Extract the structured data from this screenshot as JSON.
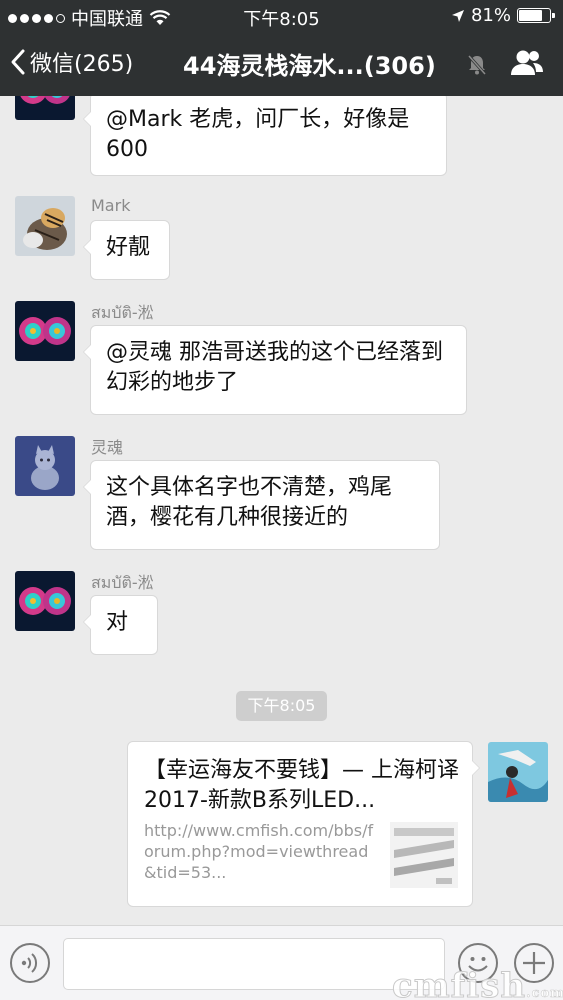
{
  "status_bar": {
    "carrier": "中国联通",
    "time": "下午8:05",
    "battery": "81%",
    "battery_level": 0.81
  },
  "nav": {
    "back_label": "微信(265)",
    "title": "44海灵栈海水...(306)"
  },
  "messages": [
    {
      "sender": "",
      "text": "@Mark 老虎，问厂长，好像是600"
    },
    {
      "sender": "Mark",
      "text": "好靓"
    },
    {
      "sender": "สมบัติ-淞",
      "text": "@灵魂 那浩哥送我的这个已经落到幻彩的地步了"
    },
    {
      "sender": "灵魂",
      "text": "这个具体名字也不清楚，鸡尾酒，樱花有几种很接近的"
    },
    {
      "sender": "สมบัติ-淞",
      "text": "对"
    }
  ],
  "timestamp": "下午8:05",
  "link_card": {
    "title": "【幸运海友不要钱】— 上海柯译2017-新款B系列LED...",
    "description": "http://www.cmfish.com/bbs/forum.php?mod=viewthread&tid=53..."
  },
  "watermark": {
    "main": "cmfish",
    "suffix": ".com"
  },
  "colors": {
    "nav_bg": "#2e3132",
    "chat_bg": "#ebebeb",
    "bubble_bg": "#ffffff"
  }
}
